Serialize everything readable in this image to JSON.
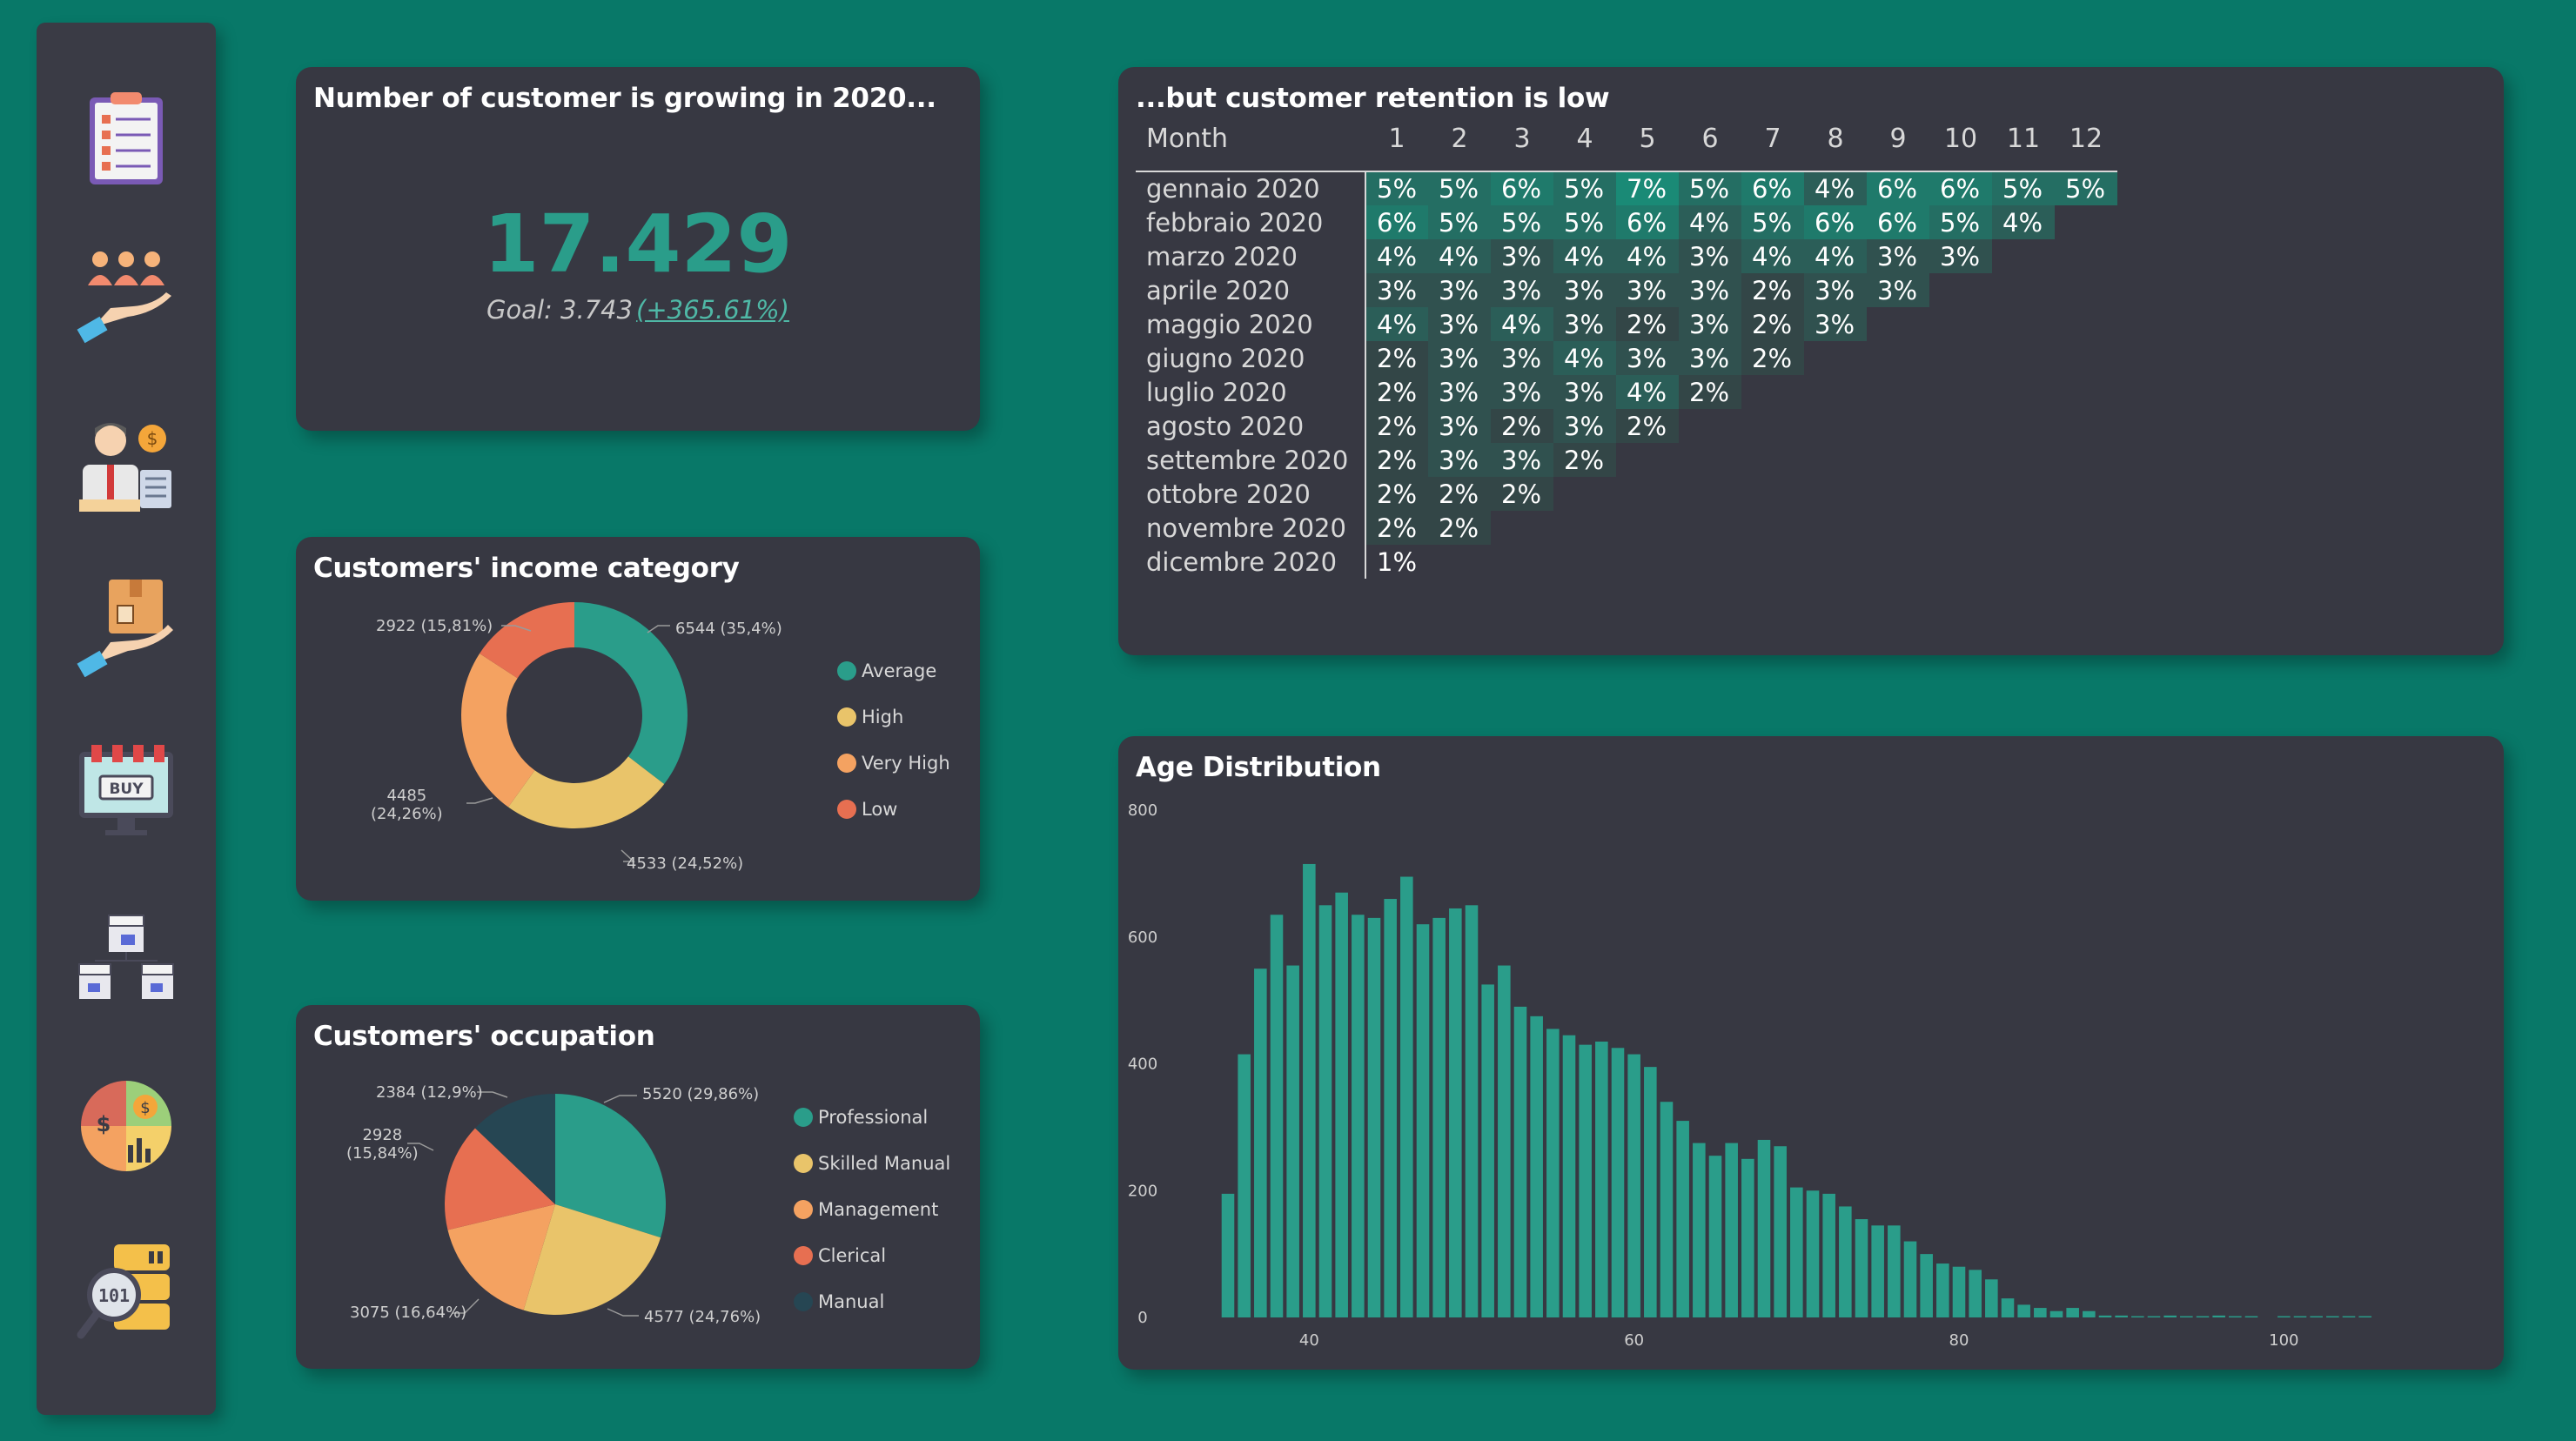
{
  "colors": {
    "background": "#087868",
    "card": "#373842",
    "teal": "#2a9d8a",
    "yellow": "#e9c46a",
    "orange": "#f4a261",
    "red": "#e76f51",
    "navy": "#264653"
  },
  "sidebar": {
    "items": [
      {
        "icon": "clipboard-checklist-icon"
      },
      {
        "icon": "customers-hand-icon"
      },
      {
        "icon": "salesman-icon"
      },
      {
        "icon": "product-hand-icon"
      },
      {
        "icon": "online-shop-icon"
      },
      {
        "icon": "store-network-icon"
      },
      {
        "icon": "finance-pie-icon"
      },
      {
        "icon": "data-search-icon"
      }
    ]
  },
  "kpi": {
    "title": "Number of customer is growing in 2020...",
    "value": "17.429",
    "goal_text": "Goal: 3.743",
    "delta": "(+365.61%)"
  },
  "income": {
    "title": "Customers' income category",
    "labels": {
      "average": "6544 (35,4%)",
      "high": "4533 (24,52%)",
      "very_high_1": "4485",
      "very_high_2": "(24,26%)",
      "low": "2922 (15,81%)"
    },
    "legend": [
      "Average",
      "High",
      "Very High",
      "Low"
    ]
  },
  "occupation": {
    "title": "Customers' occupation",
    "labels": {
      "professional": "5520 (29,86%)",
      "skilled": "4577 (24,76%)",
      "management": "3075 (16,64%)",
      "clerical_1": "2928",
      "clerical_2": "(15,84%)",
      "manual": "2384 (12,9%)"
    },
    "legend": [
      "Professional",
      "Skilled Manual",
      "Management",
      "Clerical",
      "Manual"
    ]
  },
  "retention": {
    "title": "...but customer retention is low",
    "month_header": "Month",
    "columns": [
      "1",
      "2",
      "3",
      "4",
      "5",
      "6",
      "7",
      "8",
      "9",
      "10",
      "11",
      "12"
    ],
    "rows": [
      {
        "label": "gennaio 2020",
        "values": [
          "5%",
          "5%",
          "6%",
          "5%",
          "7%",
          "5%",
          "6%",
          "4%",
          "6%",
          "6%",
          "5%",
          "5%"
        ]
      },
      {
        "label": "febbraio 2020",
        "values": [
          "6%",
          "5%",
          "5%",
          "5%",
          "6%",
          "4%",
          "5%",
          "6%",
          "6%",
          "5%",
          "4%"
        ]
      },
      {
        "label": "marzo 2020",
        "values": [
          "4%",
          "4%",
          "3%",
          "4%",
          "4%",
          "3%",
          "4%",
          "4%",
          "3%",
          "3%"
        ]
      },
      {
        "label": "aprile 2020",
        "values": [
          "3%",
          "3%",
          "3%",
          "3%",
          "3%",
          "3%",
          "2%",
          "3%",
          "3%"
        ]
      },
      {
        "label": "maggio 2020",
        "values": [
          "4%",
          "3%",
          "4%",
          "3%",
          "2%",
          "3%",
          "2%",
          "3%"
        ]
      },
      {
        "label": "giugno 2020",
        "values": [
          "2%",
          "3%",
          "3%",
          "4%",
          "3%",
          "3%",
          "2%"
        ]
      },
      {
        "label": "luglio 2020",
        "values": [
          "2%",
          "3%",
          "3%",
          "3%",
          "4%",
          "2%"
        ]
      },
      {
        "label": "agosto 2020",
        "values": [
          "2%",
          "3%",
          "2%",
          "3%",
          "2%"
        ]
      },
      {
        "label": "settembre 2020",
        "values": [
          "2%",
          "3%",
          "3%",
          "2%"
        ]
      },
      {
        "label": "ottobre 2020",
        "values": [
          "2%",
          "2%",
          "2%"
        ]
      },
      {
        "label": "novembre 2020",
        "values": [
          "2%",
          "2%"
        ]
      },
      {
        "label": "dicembre 2020",
        "values": [
          "1%"
        ]
      }
    ]
  },
  "chart_data": [
    {
      "type": "pie",
      "title": "Customers' income category",
      "categories": [
        "Average",
        "High",
        "Very High",
        "Low"
      ],
      "values": [
        6544,
        4533,
        4485,
        2922
      ],
      "colors": [
        "#2a9d8a",
        "#e9c46a",
        "#f4a261",
        "#e76f51"
      ],
      "donut": true,
      "legend_position": "right"
    },
    {
      "type": "pie",
      "title": "Customers' occupation",
      "categories": [
        "Professional",
        "Skilled Manual",
        "Management",
        "Clerical",
        "Manual"
      ],
      "values": [
        5520,
        4577,
        3075,
        2928,
        2384
      ],
      "colors": [
        "#2a9d8a",
        "#e9c46a",
        "#f4a261",
        "#e76f51",
        "#264653"
      ],
      "donut": false,
      "legend_position": "right"
    },
    {
      "type": "bar",
      "title": "Age Distribution",
      "x_ticks": [
        "40",
        "60",
        "80",
        "100"
      ],
      "y_ticks": [
        "0",
        "200",
        "400",
        "600",
        "800"
      ],
      "ylim": [
        0,
        800
      ],
      "xlim": [
        32,
        107
      ],
      "x": [
        35,
        36,
        37,
        38,
        39,
        40,
        41,
        42,
        43,
        44,
        45,
        46,
        47,
        48,
        49,
        50,
        51,
        52,
        53,
        54,
        55,
        56,
        57,
        58,
        59,
        60,
        61,
        62,
        63,
        64,
        65,
        66,
        67,
        68,
        69,
        70,
        71,
        72,
        73,
        74,
        75,
        76,
        77,
        78,
        79,
        80,
        81,
        82,
        83,
        84,
        85,
        86,
        87,
        88,
        89,
        90,
        91,
        92,
        93,
        94,
        95,
        96,
        97,
        98,
        99,
        100,
        101,
        102,
        103,
        104,
        105
      ],
      "values": [
        195,
        415,
        550,
        635,
        555,
        715,
        650,
        670,
        635,
        630,
        660,
        695,
        620,
        630,
        645,
        650,
        525,
        555,
        490,
        475,
        455,
        445,
        430,
        435,
        425,
        415,
        395,
        340,
        310,
        275,
        255,
        275,
        250,
        280,
        270,
        205,
        200,
        195,
        175,
        155,
        145,
        145,
        120,
        100,
        85,
        80,
        75,
        60,
        30,
        20,
        15,
        10,
        15,
        10,
        3,
        3,
        2,
        2,
        3,
        2,
        2,
        3,
        2,
        2,
        0,
        2,
        2,
        2,
        2,
        2,
        2
      ],
      "color": "#2a9d8a"
    }
  ]
}
